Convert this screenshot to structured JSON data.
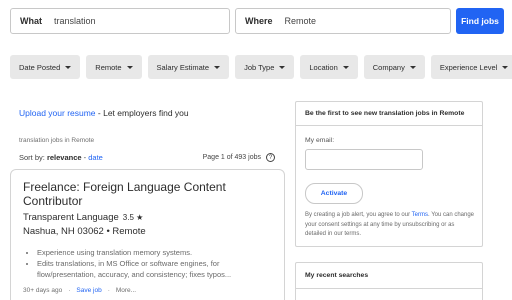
{
  "search": {
    "what_label": "What",
    "what_value": "translation",
    "where_label": "Where",
    "where_value": "Remote",
    "find_button": "Find jobs"
  },
  "filters": [
    {
      "label": "Date Posted"
    },
    {
      "label": "Remote"
    },
    {
      "label": "Salary Estimate"
    },
    {
      "label": "Job Type"
    },
    {
      "label": "Location"
    },
    {
      "label": "Company"
    },
    {
      "label": "Experience Level"
    }
  ],
  "upload": {
    "link_text": "Upload your resume",
    "suffix": " - Let employers find you"
  },
  "results": {
    "breadcrumb": "translation jobs in Remote",
    "sort_prefix": "Sort by: ",
    "sort_active": "relevance",
    "sort_separator": " - ",
    "sort_alt": "date",
    "page_info": "Page 1 of 493 jobs",
    "help_icon_glyph": "?"
  },
  "job": {
    "title": "Freelance: Foreign Language Content Contributor",
    "company": "Transparent Language",
    "rating": "3.5 ★",
    "location": "Nashua, NH 03062 • Remote",
    "bullets": [
      "Experience using translation memory systems.",
      "Edits translations, in MS Office or software engines, for flow/presentation, accuracy, and consistency; fixes typos..."
    ],
    "posted": "30+ days ago",
    "dot": "·",
    "save": "Save job",
    "more": "More..."
  },
  "alert": {
    "heading": "Be the first to see new translation jobs in Remote",
    "email_label": "My email:",
    "activate": "Activate",
    "consent_prefix": "By creating a job alert, you agree to our ",
    "terms": "Terms",
    "consent_suffix": ". You can change your consent settings at any time by unsubscribing or as detailed in our terms."
  },
  "recent": {
    "heading": "My recent searches"
  },
  "colors": {
    "accent": "#2164f3",
    "filter_bg": "#e8e8e8",
    "border": "#d4d4d4"
  }
}
